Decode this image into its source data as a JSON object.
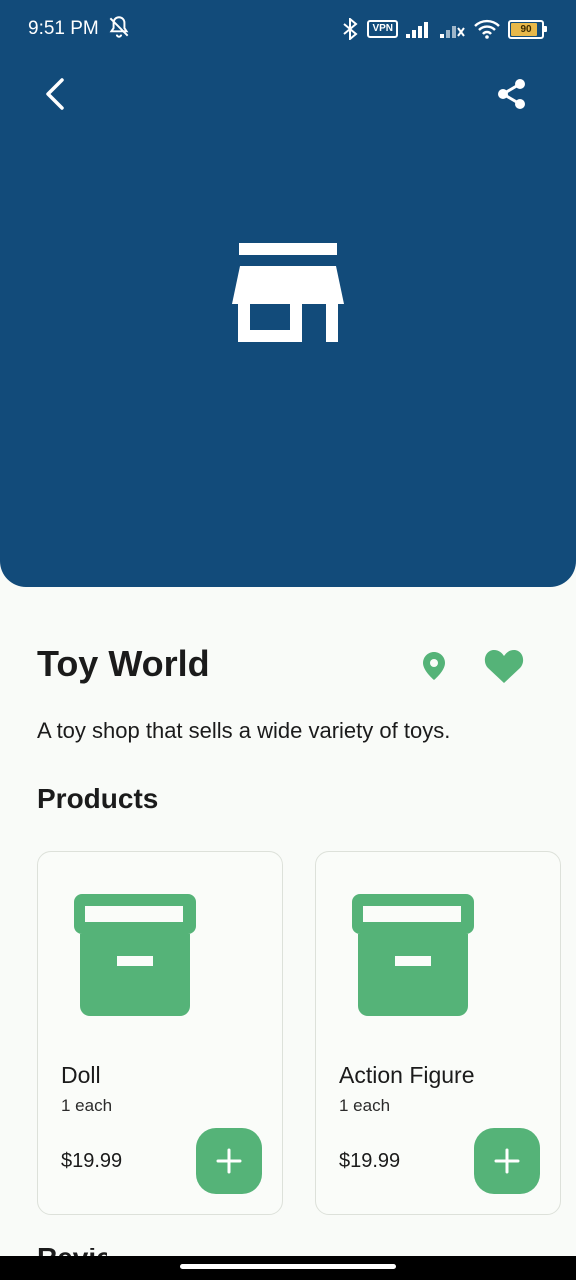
{
  "status_bar": {
    "time": "9:51 PM",
    "vpn": "VPN",
    "battery": "90",
    "icons": [
      "mute-icon",
      "bluetooth-icon",
      "signal-icon",
      "wifi-icon",
      "battery-icon"
    ]
  },
  "colors": {
    "header": "#124b7a",
    "accent": "#55b378",
    "background": "#f9fbf8"
  },
  "header": {
    "back_icon": "chevron-left-icon",
    "share_icon": "share-icon",
    "hero_icon": "store-icon"
  },
  "shop": {
    "name": "Toy World",
    "description": "A toy shop that sells a wide variety of toys.",
    "location_icon": "location-pin-icon",
    "favorite_icon": "heart-icon"
  },
  "products_section": {
    "title": "Products",
    "items": [
      {
        "name": "Doll",
        "unit": "1 each",
        "price": "$19.99",
        "icon": "archive-box-icon"
      },
      {
        "name": "Action Figure",
        "unit": "1 each",
        "price": "$19.99",
        "icon": "archive-box-icon"
      }
    ]
  },
  "next_section": {
    "title": "Reviews"
  }
}
